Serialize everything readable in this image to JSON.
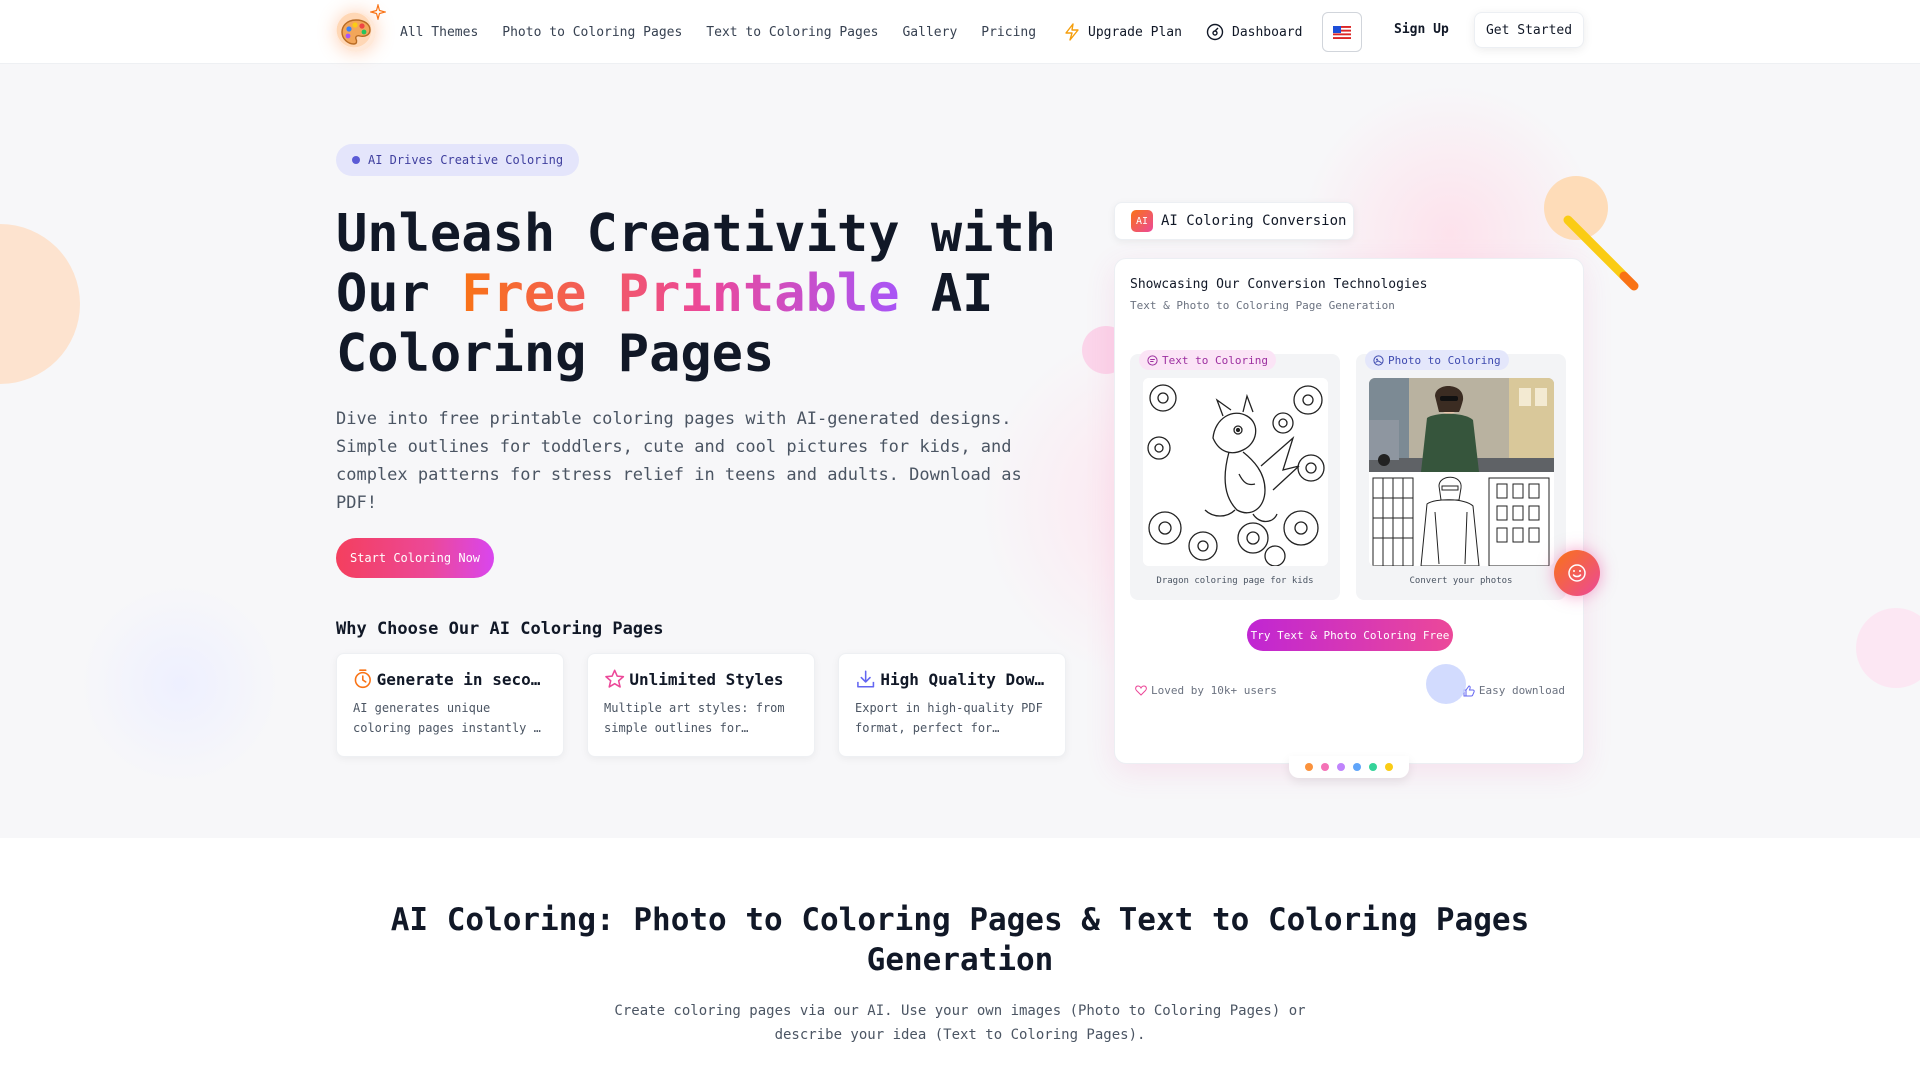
{
  "header": {
    "nav": [
      "All Themes",
      "Photo to Coloring Pages",
      "Text to Coloring Pages",
      "Gallery",
      "Pricing"
    ],
    "upgrade_label": "Upgrade Plan",
    "dashboard_label": "Dashboard",
    "language_icon": "us-flag-icon",
    "signup_label": "Sign Up",
    "get_started_label": "Get Started"
  },
  "hero": {
    "badge": "AI Drives Creative Coloring",
    "title_part1": "Unleash Creativity with Our ",
    "title_highlight": "Free Printable",
    "title_part2": " AI Coloring Pages",
    "description": "Dive into free printable coloring pages with AI-generated designs. Simple outlines for toddlers, cute and cool pictures for kids, and complex patterns for stress relief in teens and adults. Download as PDF!",
    "cta_label": "Start Coloring Now",
    "why_title": "Why Choose Our AI Coloring Pages",
    "features": [
      {
        "icon": "timer-icon",
        "title": "Generate in seconds",
        "desc": "AI generates unique coloring pages instantly - no waiting"
      },
      {
        "icon": "star-icon",
        "title": "Unlimited Styles",
        "desc": "Multiple art styles: from simple outlines for toddlers to complex patterns"
      },
      {
        "icon": "download-icon",
        "title": "High Quality Downloads",
        "desc": "Export in high-quality PDF format, perfect for printing at home"
      }
    ]
  },
  "showcase": {
    "tab_chip": "AI",
    "tab_label": "AI Coloring Conversion",
    "title": "Showcasing Our Conversion Technologies",
    "subtitle": "Text & Photo to Coloring Page Generation",
    "left_pill": "Text to Coloring",
    "left_caption": "Dragon coloring page for kids",
    "right_pill": "Photo to Coloring",
    "right_caption": "Convert your photos",
    "try_label": "Try Text & Photo Coloring Free",
    "loved_label": "Loved by 10k+ users",
    "easy_label": "Easy download",
    "dot_colors": [
      "#fb923c",
      "#f472b6",
      "#c084fc",
      "#60a5fa",
      "#34d399",
      "#facc15"
    ]
  },
  "section2": {
    "title": "AI Coloring: Photo to Coloring Pages & Text to Coloring Pages Generation",
    "description": "Create coloring pages via our AI. Use your own images (Photo to Coloring Pages) or describe your idea (Text to Coloring Pages)."
  },
  "colors": {
    "accent_orange": "#f97316",
    "accent_pink": "#ec4899",
    "accent_purple": "#a855f7",
    "badge_bg": "#e4e5fb"
  }
}
